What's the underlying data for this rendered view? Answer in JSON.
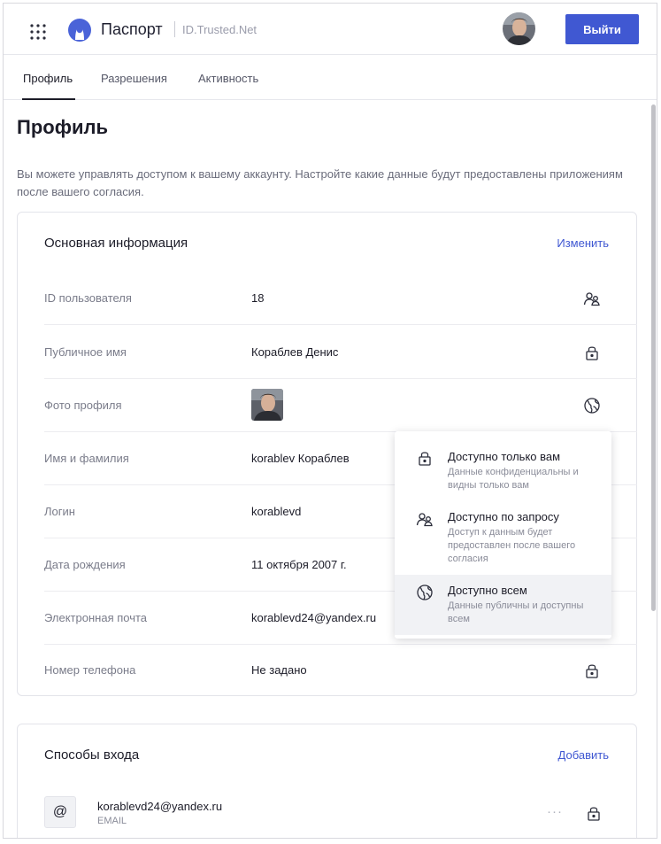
{
  "header": {
    "brand": "Паспорт",
    "brand_sub": "ID.Trusted.Net",
    "logout_label": "Выйти",
    "accent_color": "#4058d2"
  },
  "tabs": [
    {
      "label": "Профиль",
      "active": true
    },
    {
      "label": "Разрешения",
      "active": false
    },
    {
      "label": "Активность",
      "active": false
    }
  ],
  "page": {
    "title": "Профиль",
    "description": "Вы можете управлять доступом к вашему аккаунту. Настройте какие данные будут предоставлены приложениям после вашего согласия."
  },
  "basic_info": {
    "title": "Основная информация",
    "action": "Изменить",
    "rows": [
      {
        "label": "ID пользователя",
        "value": "18",
        "icon": "users-icon"
      },
      {
        "label": "Публичное имя",
        "value": "Кораблев Денис",
        "icon": "lock-icon"
      },
      {
        "label": "Фото профиля",
        "value": "",
        "icon": "globe-icon"
      },
      {
        "label": "Имя и фамилия",
        "value": "korablev Кораблев",
        "icon": ""
      },
      {
        "label": "Логин",
        "value": "korablevd",
        "icon": ""
      },
      {
        "label": "Дата рождения",
        "value": "11 октября 2007 г.",
        "icon": ""
      },
      {
        "label": "Электронная почта",
        "value": "korablevd24@yandex.ru",
        "icon": ""
      },
      {
        "label": "Номер телефона",
        "value": "Не задано",
        "icon": "lock-icon"
      }
    ]
  },
  "access_menu": {
    "options": [
      {
        "title": "Доступно только вам",
        "desc": "Данные конфиденциальны и видны только вам",
        "icon": "lock-icon",
        "selected": false
      },
      {
        "title": "Доступно по запросу",
        "desc": "Доступ к данным будет предоставлен после вашего согласия",
        "icon": "users-icon",
        "selected": false
      },
      {
        "title": "Доступно всем",
        "desc": "Данные публичны и доступны всем",
        "icon": "globe-icon",
        "selected": true
      }
    ]
  },
  "login_methods": {
    "title": "Способы входа",
    "action": "Добавить",
    "items": [
      {
        "icon_glyph": "@",
        "value": "korablevd24@yandex.ru",
        "type": "EMAIL",
        "more": "···"
      }
    ]
  }
}
